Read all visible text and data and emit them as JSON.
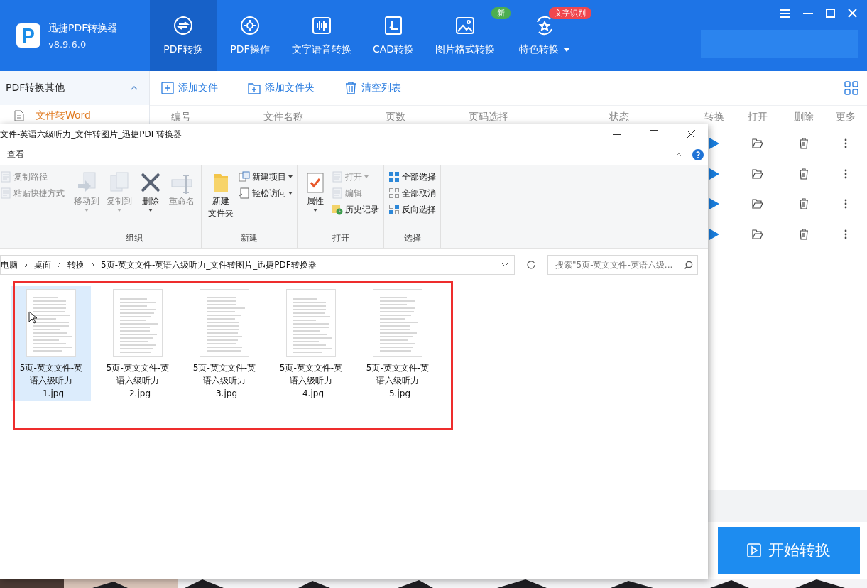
{
  "app": {
    "name": "迅捷PDF转换器",
    "version": "v8.9.6.0"
  },
  "nav_tabs": [
    {
      "label": "PDF转换",
      "selected": true
    },
    {
      "label": "PDF操作",
      "selected": false
    },
    {
      "label": "文字语音转换",
      "selected": false
    },
    {
      "label": "CAD转换",
      "selected": false
    },
    {
      "label": "图片格式转换",
      "selected": false,
      "badge": {
        "text": "新",
        "color": "#4cae4f"
      }
    },
    {
      "label": "特色转换",
      "selected": false,
      "dropdown": true,
      "badge": {
        "text": "文字识别",
        "color": "#f0474e"
      }
    }
  ],
  "sidebar": {
    "header": "PDF转换其他",
    "expanded": true,
    "items": [
      {
        "label": "文件转Word",
        "selected": true
      }
    ]
  },
  "toolbar": [
    "添加文件",
    "添加文件夹",
    "清空列表"
  ],
  "table": {
    "columns": [
      "编号",
      "文件名称",
      "页数",
      "页码选择",
      "状态",
      "转换",
      "打开",
      "删除",
      "更多"
    ]
  },
  "start_button": "开始转换",
  "explorer": {
    "title": "文件-英语六级听力_文件转图片_迅捷PDF转换器",
    "ribbon_tab": "查看",
    "groups": [
      {
        "items": [
          {
            "label": "复制路径",
            "kind": "small",
            "disabled": true,
            "dropdown": false
          },
          {
            "label": "粘贴快捷方式",
            "kind": "small",
            "disabled": true,
            "dropdown": false
          }
        ]
      },
      {
        "label": "组织",
        "items": [
          {
            "label": "移动到",
            "kind": "large",
            "disabled": true,
            "dropdown": true
          },
          {
            "label": "复制到",
            "kind": "large",
            "disabled": true,
            "dropdown": true
          },
          {
            "label": "删除",
            "kind": "large",
            "disabled": false,
            "dropdown": true
          },
          {
            "label": "重命名",
            "kind": "large",
            "disabled": true,
            "dropdown": false
          }
        ]
      },
      {
        "label": "新建",
        "items": [
          {
            "label": [
              "新建",
              "文件夹"
            ],
            "kind": "large",
            "disabled": false,
            "dropdown": false
          },
          {
            "label": "新建项目",
            "kind": "small",
            "disabled": false,
            "dropdown": true
          },
          {
            "label": "轻松访问",
            "kind": "small",
            "disabled": false,
            "dropdown": true
          }
        ]
      },
      {
        "label": "打开",
        "items": [
          {
            "label": "属性",
            "kind": "large",
            "disabled": false,
            "dropdown": true
          },
          {
            "label": "打开",
            "kind": "small",
            "disabled": true,
            "dropdown": true
          },
          {
            "label": "编辑",
            "kind": "small",
            "disabled": true,
            "dropdown": false
          },
          {
            "label": "历史记录",
            "kind": "small",
            "disabled": false,
            "dropdown": false
          }
        ]
      },
      {
        "label": "选择",
        "items": [
          {
            "label": "全部选择",
            "kind": "small",
            "disabled": false,
            "dropdown": false
          },
          {
            "label": "全部取消",
            "kind": "small",
            "disabled": false,
            "dropdown": false
          },
          {
            "label": "反向选择",
            "kind": "small",
            "disabled": false,
            "dropdown": false
          }
        ]
      }
    ],
    "breadcrumbs": [
      "电脑",
      "桌面",
      "转换",
      "5页-英文文件-英语六级听力_文件转图片_迅捷PDF转换器"
    ],
    "search": {
      "placeholder": "搜索\"5页-英文文件-英语六级..."
    },
    "files": [
      {
        "name": "5页-英文文件-英语六级听力_1.jpg",
        "selected": true
      },
      {
        "name": "5页-英文文件-英语六级听力_2.jpg",
        "selected": false
      },
      {
        "name": "5页-英文文件-英语六级听力_3.jpg",
        "selected": false
      },
      {
        "name": "5页-英文文件-英语六级听力_4.jpg",
        "selected": false
      },
      {
        "name": "5页-英文文件-英语六级听力_5.jpg",
        "selected": false
      }
    ]
  }
}
